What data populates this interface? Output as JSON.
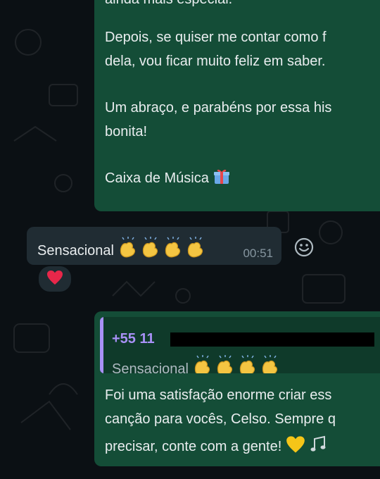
{
  "top_message": {
    "line1": "ainda mais especial.",
    "line2": "Depois, se quiser me contar como f",
    "line3": "dela, vou ficar muito feliz em saber.",
    "line4": "Um abraço, e parabéns por essa his",
    "line5": "bonita!",
    "line6": "Caixa de Música",
    "gift_icon": "gift-icon"
  },
  "incoming": {
    "text": "Sensacional",
    "emoji": "clapping-hands x4",
    "time": "00:51",
    "reaction_emoji": "red-heart"
  },
  "reply_message": {
    "quote_sender": "+55 11",
    "quote_text": "Sensacional",
    "quote_color": "#a991f7",
    "line1": "Foi uma satisfação enorme criar ess",
    "line2": "canção para vocês, Celso. Sempre q",
    "line3": "precisar, conte com a gente!",
    "trailing_emoji": "yellow-heart, musical-notes"
  },
  "colors": {
    "outgoing_bubble": "#144d37",
    "incoming_bubble": "#202c33",
    "background": "#0b1014"
  }
}
